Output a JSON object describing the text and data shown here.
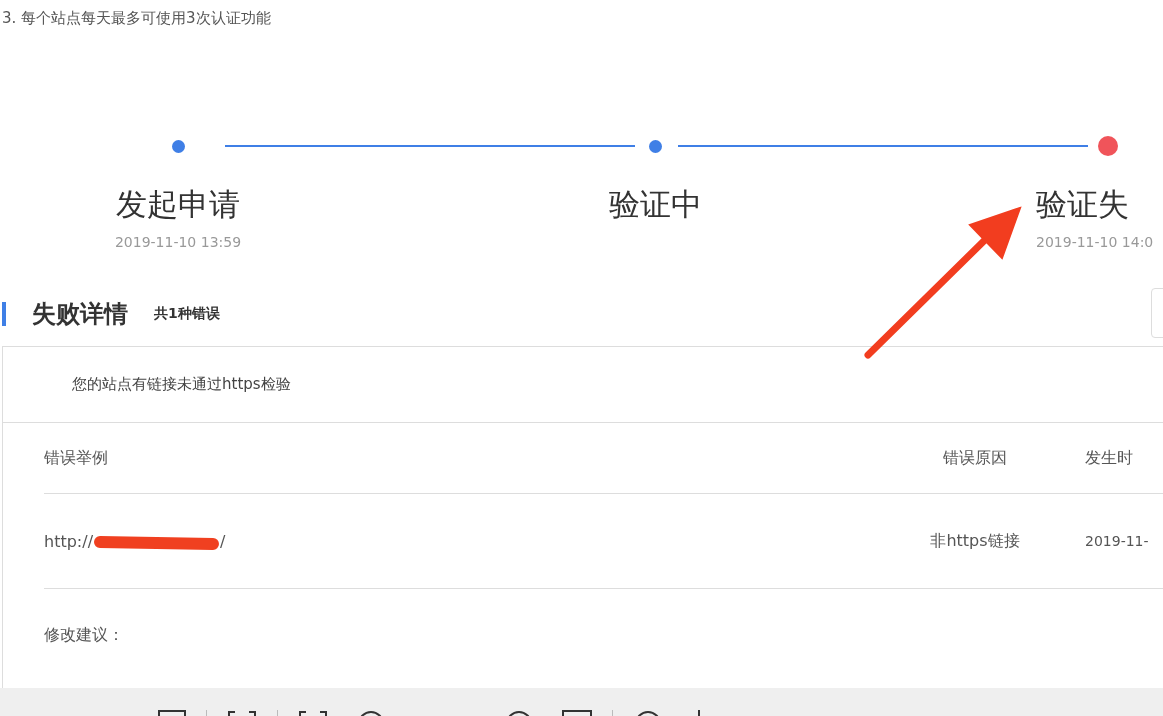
{
  "note": "3. 每个站点每天最多可使用3次认证功能",
  "steps": [
    {
      "title": "发起申请",
      "date": "2019-11-10 13:59",
      "failed": false
    },
    {
      "title": "验证中",
      "failed": false
    },
    {
      "title": "验证失",
      "date": "2019-11-10 14:0",
      "failed": true
    }
  ],
  "details": {
    "title": "失败详情",
    "count": "共1种错误",
    "message": "您的站点有链接未通过https检验",
    "columns": [
      "错误举例",
      "错误原因",
      "发生时"
    ],
    "rows": [
      {
        "url_prefix": "http://",
        "url_suffix": "/",
        "reason": "非https链接",
        "time": "2019-11-"
      }
    ],
    "suggestion_label": "修改建议："
  }
}
